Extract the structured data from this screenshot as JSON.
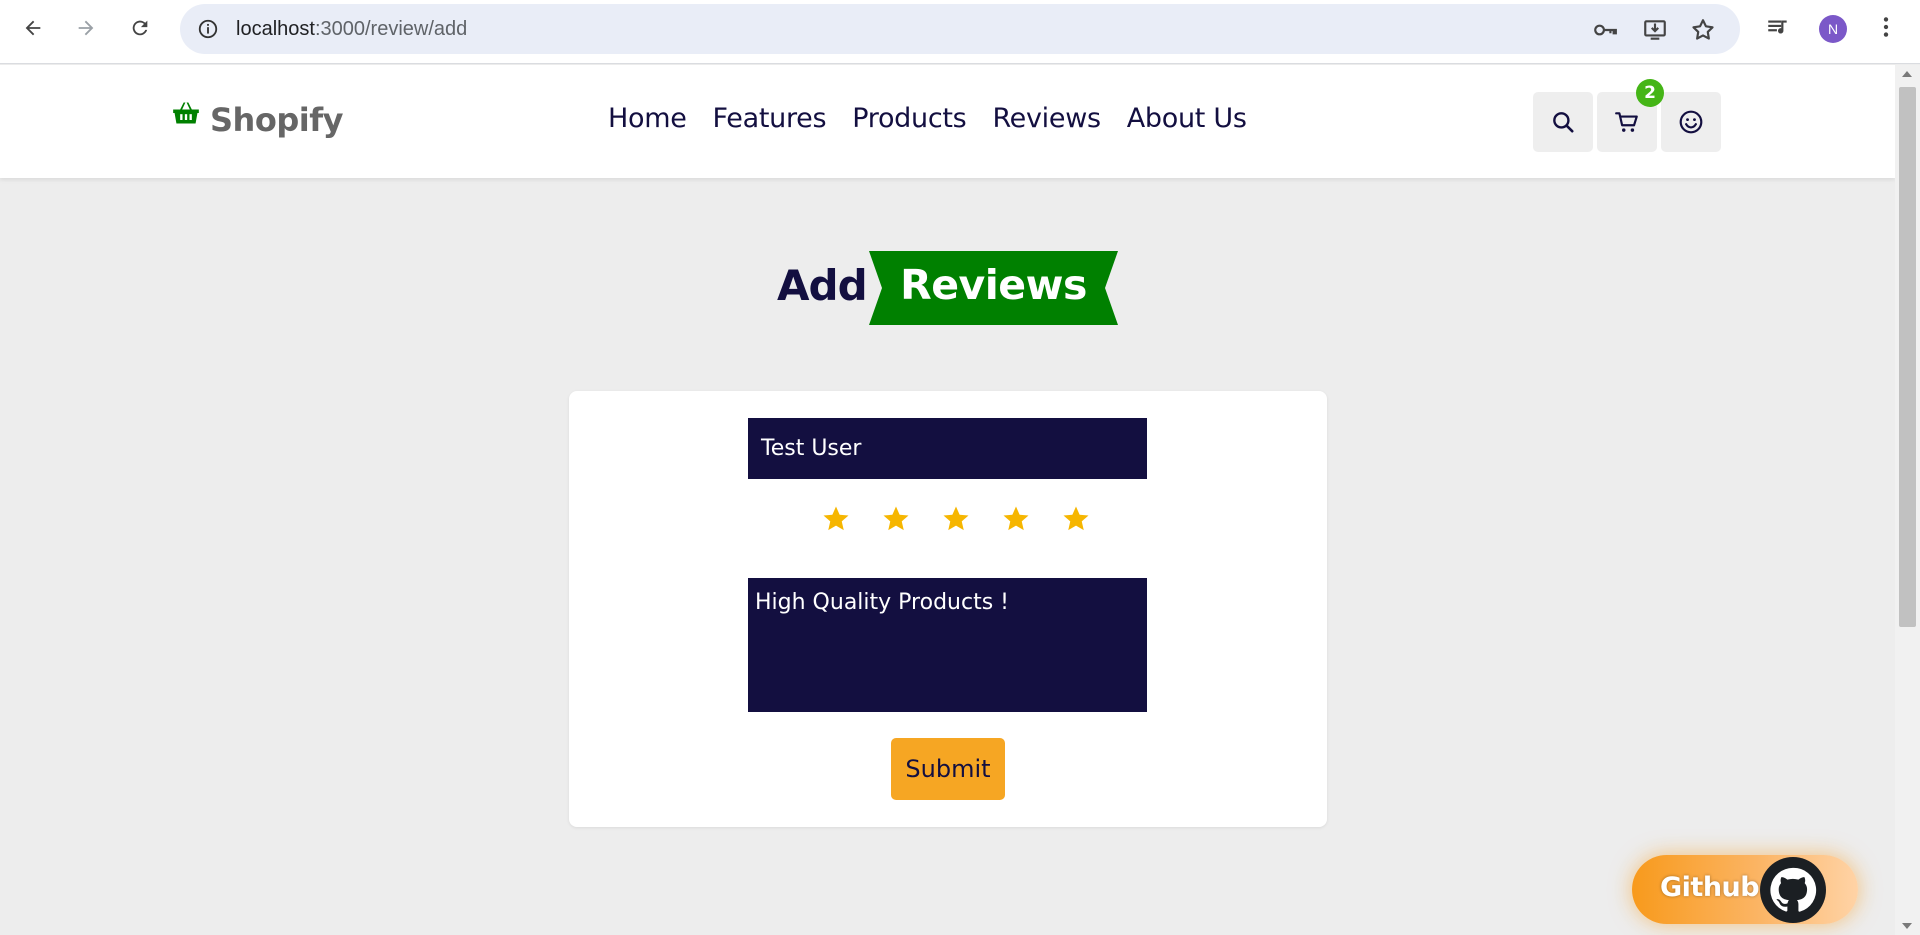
{
  "browser": {
    "url_host": "localhost",
    "url_path": ":3000/review/add",
    "profile_initial": "N",
    "icons": [
      "back-arrow-icon",
      "forward-arrow-icon",
      "reload-icon",
      "site-info-icon",
      "password-key-icon",
      "install-app-icon",
      "bookmark-star-icon",
      "media-control-icon",
      "more-vert-icon"
    ]
  },
  "site": {
    "logo_text": "Shopify",
    "logo_icon": "shopping-basket-icon",
    "nav": [
      "Home",
      "Features",
      "Products",
      "Reviews",
      "About Us"
    ],
    "cart_count": "2",
    "accent_color": "#008000",
    "brand_dark": "#130f40"
  },
  "heading": {
    "plain": "Add",
    "highlight": "Reviews"
  },
  "form": {
    "name_value": "Test User",
    "rating": 5,
    "rating_max": 5,
    "star_color": "#f6b600",
    "review_value": "High Quality Products !",
    "submit_label": "Submit"
  },
  "github": {
    "label": "Github"
  }
}
